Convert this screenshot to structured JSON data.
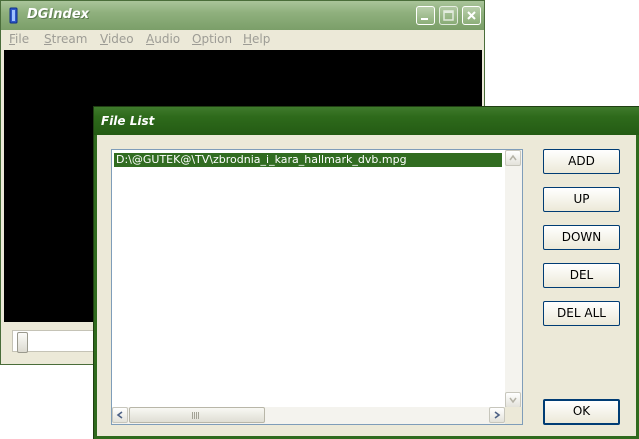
{
  "main_window": {
    "title": "DGIndex",
    "menu": [
      {
        "label": "File",
        "accel": "F",
        "rest": "ile"
      },
      {
        "label": "Stream",
        "accel": "S",
        "rest": "tream"
      },
      {
        "label": "Video",
        "accel": "V",
        "rest": "ideo"
      },
      {
        "label": "Audio",
        "accel": "A",
        "rest": "udio"
      },
      {
        "label": "Option",
        "accel": "O",
        "rest": "ption"
      },
      {
        "label": "Help",
        "accel": "H",
        "rest": "elp"
      }
    ]
  },
  "dialog": {
    "title": "File List",
    "files": [
      "D:\\@GUTEK@\\TV\\zbrodnia_i_kara_hallmark_dvb.mpg"
    ],
    "buttons": {
      "add": "ADD",
      "up": "UP",
      "down": "DOWN",
      "del": "DEL",
      "del_all": "DEL ALL",
      "ok": "OK"
    }
  },
  "colors": {
    "inactive_title": "#8fb07d",
    "active_title": "#2e6a1b",
    "selection": "#316c21"
  },
  "icons": [
    "dgindex-app-icon",
    "minimize-icon",
    "maximize-icon",
    "close-icon",
    "arrow-up-icon",
    "arrow-down-icon",
    "arrow-left-icon",
    "arrow-right-icon"
  ]
}
